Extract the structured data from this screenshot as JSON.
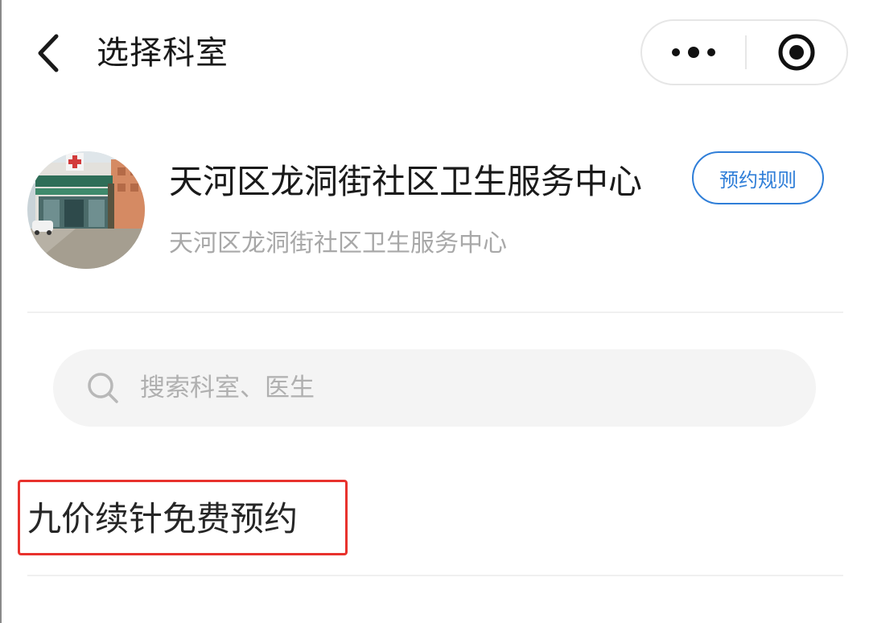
{
  "nav": {
    "title": "选择科室",
    "back_icon": "chevron-left-icon",
    "more_icon": "more-dots-icon",
    "close_icon": "record-target-icon"
  },
  "hospital": {
    "name": "天河区龙洞街社区卫生服务中心",
    "subtitle": "天河区龙洞街社区卫生服务中心",
    "rules_button": "预约规则",
    "avatar": "hospital-building-photo"
  },
  "search": {
    "placeholder": "搜索科室、医生",
    "icon": "search-icon"
  },
  "departments": [
    {
      "label": "九价续针免费预约",
      "highlighted": true
    }
  ],
  "colors": {
    "accent": "#2f7ed8",
    "highlight_border": "#e8322d",
    "search_bg": "#f4f4f4",
    "muted_text": "#a8a8a8"
  }
}
